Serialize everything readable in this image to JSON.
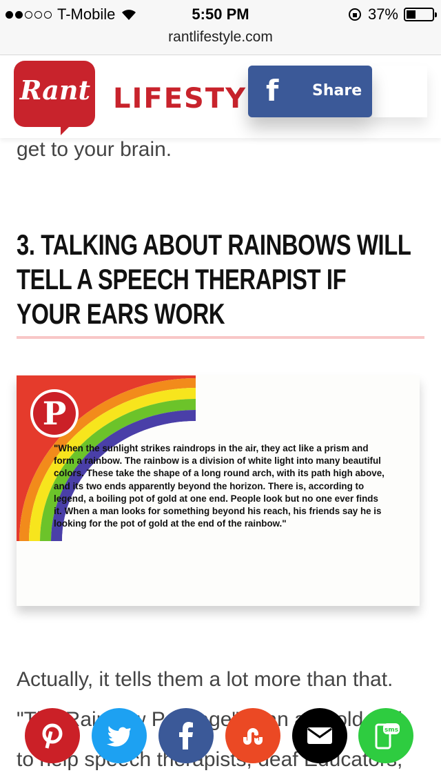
{
  "status_bar": {
    "carrier": "T-Mobile",
    "time": "5:50 PM",
    "battery": "37%",
    "battery_level": 0.37,
    "signal_bars": 2
  },
  "browser": {
    "url": "rantlifestyle.com"
  },
  "header": {
    "logo_text": "Rant",
    "logo_word": "LIFESTYLE",
    "share_icon": "f",
    "share_label": "Share"
  },
  "article": {
    "fragment": "get to your brain.",
    "heading": "3. TALKING ABOUT RAINBOWS WILL TELL A SPEECH THERAPIST IF YOUR EARS WORK",
    "figure_quote": "\"When the sunlight strikes raindrops in the air, they act like a prism and form a rainbow. The rainbow is a division of white light into many beautiful colors. These take the shape of a long round arch, with its path high above, and its two ends apparently beyond the horizon. There is, according to legend, a boiling pot of gold at one end. People look but no one ever finds it. When a man looks for something beyond his reach, his friends say he is looking for the pot of gold at the end of the rainbow.\"",
    "pin_icon": "P",
    "paragraph": "Actually, it tells them a lot more than that. \"The Rainbow Passage\" is an age-old tool to help speech therapists, deaf Educators, Audiologists and"
  },
  "share_bar": [
    {
      "name": "pinterest",
      "icon": "pinterest-icon",
      "color": "#cb2027"
    },
    {
      "name": "twitter",
      "icon": "twitter-icon",
      "color": "#1da1f2"
    },
    {
      "name": "facebook",
      "icon": "facebook-icon",
      "color": "#3b5998"
    },
    {
      "name": "stumbleupon",
      "icon": "stumbleupon-icon",
      "color": "#eb4924"
    },
    {
      "name": "email",
      "icon": "email-icon",
      "color": "#000000"
    },
    {
      "name": "sms",
      "icon": "sms-icon",
      "color": "#2ecc40",
      "label": "sms"
    }
  ],
  "colors": {
    "brand_red": "#c8232c",
    "facebook": "#3b5998",
    "heading_rule": "#f8c7c7"
  }
}
